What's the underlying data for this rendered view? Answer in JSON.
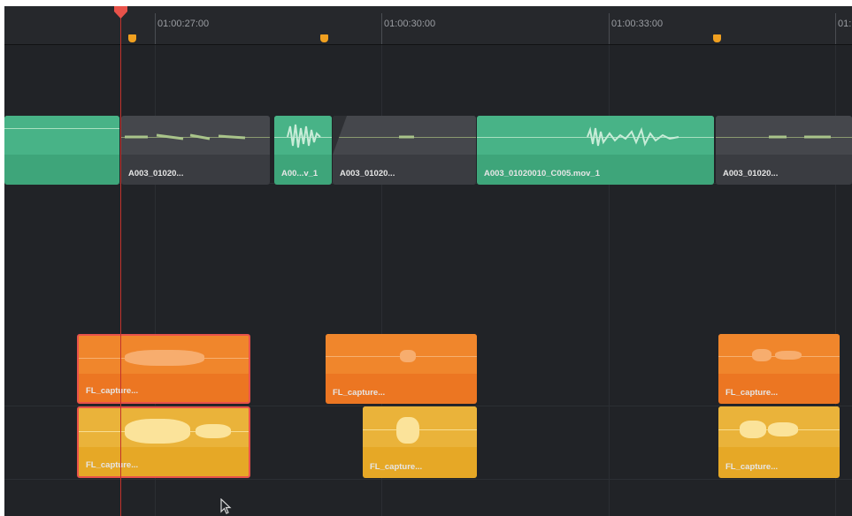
{
  "ruler": {
    "timecodes": [
      "01:00:27:00",
      "01:00:30:00",
      "01:00:33:00",
      "01:"
    ]
  },
  "colors": {
    "background": "#212327",
    "playhead": "#e8524a",
    "marker": "#f0a020",
    "audio_clip_green": "#3ea57a",
    "audio_clip_gray": "#3a3c41",
    "clip_orange": "#ec7622",
    "clip_yellow": "#e6a826",
    "selection_border": "#e8524a"
  },
  "tracks": {
    "audio1": {
      "clips": [
        {
          "name": "",
          "color": "green"
        },
        {
          "name": "A003_01020...",
          "color": "gray"
        },
        {
          "name": "A00...v_1",
          "color": "green"
        },
        {
          "name": "A003_01020...",
          "color": "gray"
        },
        {
          "name": "A003_01020010_C005.mov_1",
          "color": "green"
        },
        {
          "name": "A003_01020...",
          "color": "gray"
        }
      ]
    },
    "fl_capture_a": {
      "clips": [
        {
          "name": "FL_capture...",
          "color": "orange",
          "selected": true
        },
        {
          "name": "FL_capture...",
          "color": "orange",
          "selected": false
        },
        {
          "name": "FL_capture...",
          "color": "orange",
          "selected": false
        }
      ]
    },
    "fl_capture_b": {
      "clips": [
        {
          "name": "FL_capture...",
          "color": "yellow",
          "selected": true
        },
        {
          "name": "FL_capture...",
          "color": "yellow",
          "selected": false
        },
        {
          "name": "FL_capture...",
          "color": "yellow",
          "selected": false
        }
      ]
    }
  },
  "icons": {
    "playhead": "playhead-icon",
    "marker": "marker-icon",
    "cursor": "mouse-pointer-icon"
  }
}
